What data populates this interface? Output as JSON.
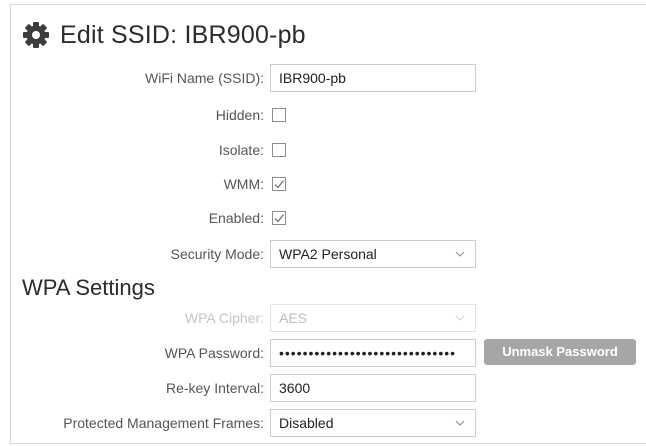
{
  "title": {
    "icon": "gear-icon",
    "text": "Edit SSID: IBR900-pb"
  },
  "fields": {
    "ssid": {
      "label": "WiFi Name (SSID):",
      "value": "IBR900-pb"
    },
    "hidden": {
      "label": "Hidden:",
      "checked": false
    },
    "isolate": {
      "label": "Isolate:",
      "checked": false
    },
    "wmm": {
      "label": "WMM:",
      "checked": true
    },
    "enabled": {
      "label": "Enabled:",
      "checked": true
    },
    "security_mode": {
      "label": "Security Mode:",
      "value": "WPA2 Personal"
    }
  },
  "wpa": {
    "section_title": "WPA Settings",
    "cipher": {
      "label": "WPA Cipher:",
      "value": "AES",
      "disabled": true
    },
    "password": {
      "label": "WPA Password:",
      "value": "••••••••••••••••••••••••••••••"
    },
    "unmask_button": "Unmask Password",
    "rekey": {
      "label": "Re-key Interval:",
      "value": "3600"
    },
    "pmf": {
      "label": "Protected Management Frames:",
      "value": "Disabled"
    }
  },
  "colors": {
    "button_bg": "#a6a6a6",
    "text": "#555555",
    "disabled_text": "#c4c4c4"
  }
}
